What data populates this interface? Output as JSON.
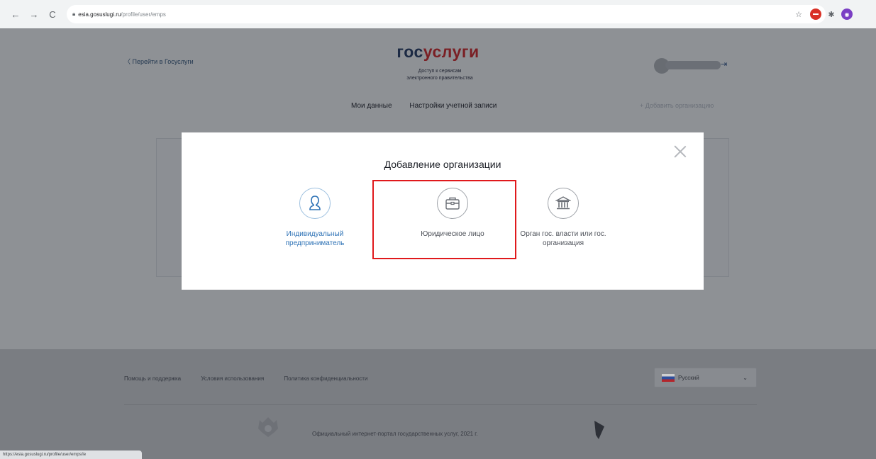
{
  "browser": {
    "url_host": "esia.gosuslugi.ru",
    "url_path": "/profile/user/emps",
    "status_url": "https://esia.gosuslugi.ru/profile/user/emps/le"
  },
  "header": {
    "back_link": "〈 Перейти в Госуслуги",
    "logo_gos": "гос",
    "logo_uslugi": "услуги",
    "subtitle_line1": "Доступ к сервисам",
    "subtitle_line2": "электронного правительства",
    "menu": [
      "Мои данные",
      "Настройки учетной записи"
    ],
    "add_org": "+ Добавить организацию"
  },
  "modal": {
    "title": "Добавление организации",
    "options": [
      {
        "label_line1": "Индивидуальный",
        "label_line2": "предприниматель",
        "icon": "person-icon"
      },
      {
        "label_line1": "Юридическое лицо",
        "label_line2": "",
        "icon": "briefcase-icon"
      },
      {
        "label_line1": "Орган гос. власти или гос.",
        "label_line2": "организация",
        "icon": "building-icon"
      }
    ]
  },
  "footer": {
    "links": [
      "Помощь и поддержка",
      "Условия использования",
      "Политика конфиденциальности"
    ],
    "language": "Русский",
    "copyright": "Официальный интернет-портал государственных услуг, 2021 г."
  },
  "colors": {
    "overlay": "#8e9195",
    "highlight": "#e0191c",
    "link_blue": "#2f73b6",
    "logo_red": "#7a1f24"
  }
}
